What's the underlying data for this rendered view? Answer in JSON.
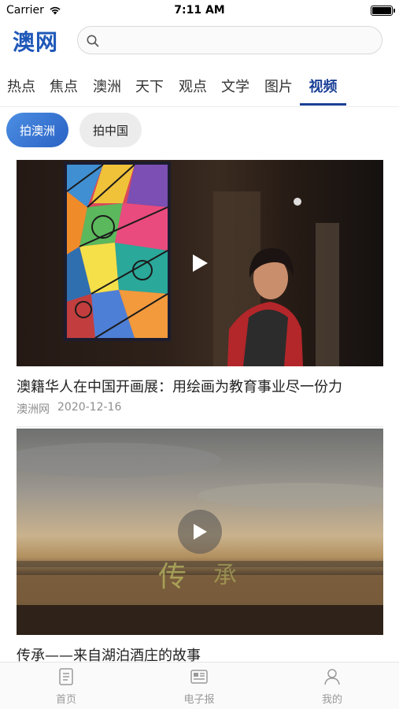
{
  "status_bar": {
    "carrier": "Carrier",
    "time": "7:11 AM"
  },
  "header": {
    "logo": "澳网",
    "search_placeholder": ""
  },
  "tabs": [
    {
      "label": "热点",
      "active": false
    },
    {
      "label": "焦点",
      "active": false
    },
    {
      "label": "澳洲",
      "active": false
    },
    {
      "label": "天下",
      "active": false
    },
    {
      "label": "观点",
      "active": false
    },
    {
      "label": "文学",
      "active": false
    },
    {
      "label": "图片",
      "active": false
    },
    {
      "label": "视频",
      "active": true
    }
  ],
  "subtabs": [
    {
      "label": "拍澳洲",
      "active": true
    },
    {
      "label": "拍中国",
      "active": false
    }
  ],
  "videos": [
    {
      "title": "澳籍华人在中国开画展：用绘画为教育事业尽一份力",
      "source": "澳洲网",
      "date": "2020-12-16"
    },
    {
      "title": "传承——来自湖泊酒庄的故事"
    }
  ],
  "bottom_nav": [
    {
      "label": "首页",
      "icon": "document-icon"
    },
    {
      "label": "电子报",
      "icon": "newspaper-icon"
    },
    {
      "label": "我的",
      "icon": "person-icon"
    }
  ],
  "colors": {
    "brand_blue": "#1f58b8",
    "active_tab": "#1a3f97",
    "pill_active_start": "#4c8ee3",
    "pill_active_end": "#2a62c4",
    "meta_gray": "#8e8e8e"
  }
}
